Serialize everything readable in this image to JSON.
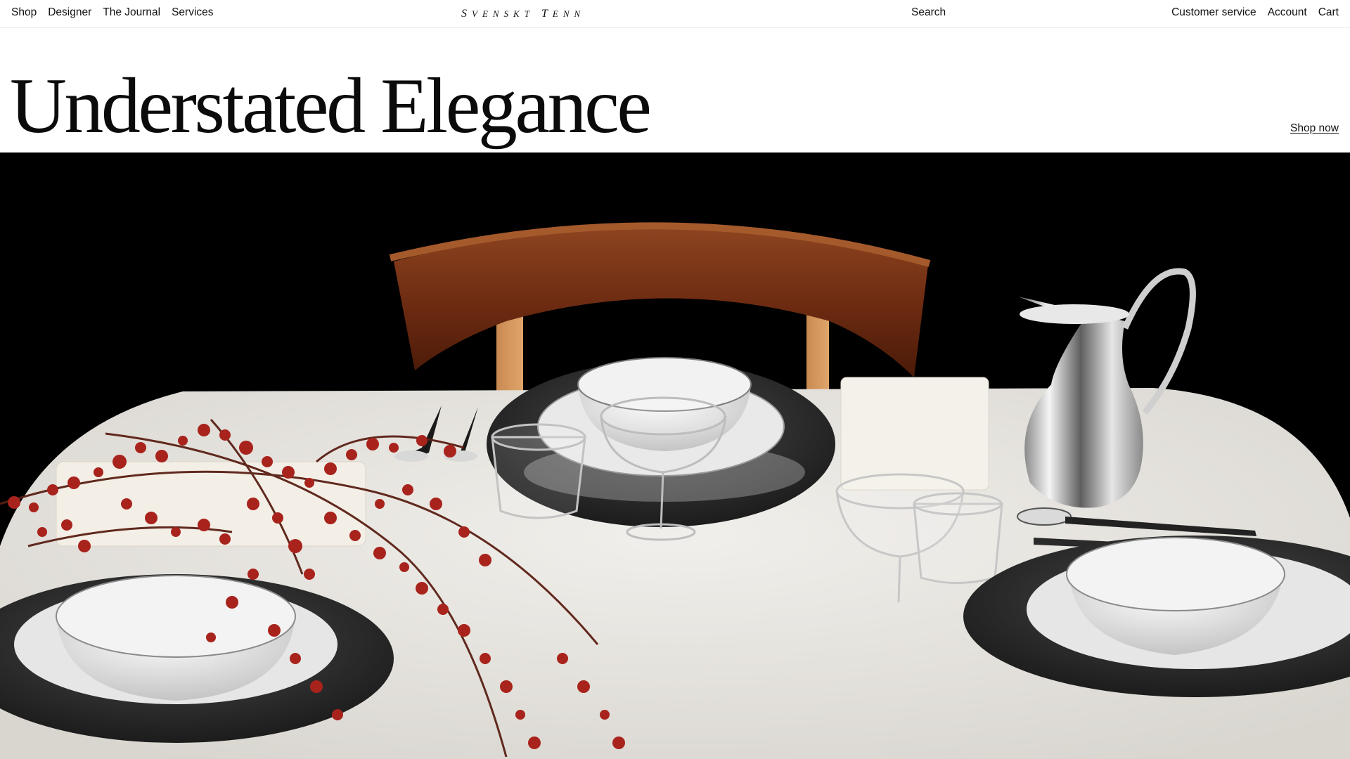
{
  "nav": {
    "left": [
      {
        "label": "Shop"
      },
      {
        "label": "Designer"
      },
      {
        "label": "The Journal"
      },
      {
        "label": "Services"
      }
    ],
    "logo_caps": [
      "S",
      "T"
    ],
    "logo_rest": [
      "VENSKT",
      "ENN"
    ],
    "search_label": "Search",
    "right": [
      {
        "label": "Customer service"
      },
      {
        "label": "Account"
      },
      {
        "label": "Cart"
      }
    ]
  },
  "hero": {
    "title": "Understated Elegance",
    "cta_label": "Shop now",
    "image_subject": "table-setting-photo"
  },
  "colors": {
    "background": "#ffffff",
    "text": "#111111",
    "hero_bg": "#000000",
    "tablecloth": "#e9e7e3",
    "chair_wood": "#7a3517",
    "blossom": "#a8231c"
  }
}
